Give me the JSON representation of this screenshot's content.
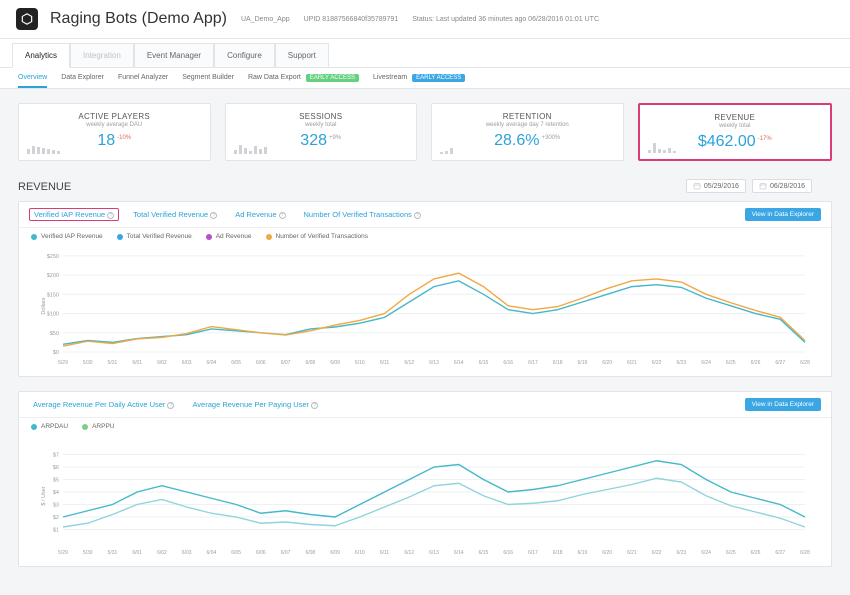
{
  "header": {
    "app_title": "Raging Bots (Demo App)",
    "project_label": "UA_Demo_App",
    "upid": "UPID 81887566840f35789791",
    "status": "Status: Last updated 36 minutes ago 06/28/2016 01:01 UTC"
  },
  "tabs": {
    "analytics": "Analytics",
    "integration": "Integration",
    "event_manager": "Event Manager",
    "configure": "Configure",
    "support": "Support"
  },
  "subtabs": {
    "overview": "Overview",
    "data_explorer": "Data Explorer",
    "funnel": "Funnel Analyzer",
    "segment": "Segment Builder",
    "raw": "Raw Data Export",
    "livestream": "Livestream",
    "badge_early": "EARLY ACCESS"
  },
  "cards": {
    "active_players": {
      "title": "ACTIVE PLAYERS",
      "sub": "weekly average DAU",
      "value": "18",
      "delta": "-10%"
    },
    "sessions": {
      "title": "SESSIONS",
      "sub": "weekly total",
      "value": "328",
      "delta": "+9%"
    },
    "retention": {
      "title": "RETENTION",
      "sub": "weekly average day 7 retention",
      "value": "28.6%",
      "delta": "+300%"
    },
    "revenue": {
      "title": "REVENUE",
      "sub": "weekly total",
      "value": "$462.00",
      "delta": "-17%"
    }
  },
  "section": {
    "revenue_title": "REVENUE"
  },
  "dates": {
    "from": "05/29/2016",
    "to": "06/28/2016"
  },
  "panel1": {
    "tabs": {
      "verified_iap": "Verified IAP Revenue",
      "total_verified": "Total Verified Revenue",
      "ad": "Ad Revenue",
      "num_tx": "Number Of Verified Transactions"
    },
    "view_btn": "View in Data Explorer",
    "legend": {
      "verified_iap": "Verified IAP Revenue",
      "total_verified": "Total Verified Revenue",
      "ad": "Ad Revenue",
      "num_tx": "Number of Verified Transactions"
    },
    "ylabel": "Dollars"
  },
  "panel2": {
    "tabs": {
      "arpdau": "Average Revenue Per Daily Active User",
      "arppu": "Average Revenue Per Paying User"
    },
    "view_btn": "View in Data Explorer",
    "legend": {
      "arpdau": "ARPDAU",
      "arppu": "ARPPU"
    },
    "ylabel": "$ / User"
  },
  "chart_data": [
    {
      "type": "line",
      "title": "Revenue",
      "xlabel": "",
      "ylabel": "Dollars",
      "ylim": [
        0,
        260
      ],
      "x": [
        "5/29",
        "5/30",
        "5/31",
        "6/01",
        "6/02",
        "6/03",
        "6/04",
        "6/05",
        "6/06",
        "6/07",
        "6/08",
        "6/09",
        "6/10",
        "6/11",
        "6/12",
        "6/13",
        "6/14",
        "6/15",
        "6/16",
        "6/17",
        "6/18",
        "6/19",
        "6/20",
        "6/21",
        "6/22",
        "6/23",
        "6/24",
        "6/25",
        "6/26",
        "6/27",
        "6/28"
      ],
      "series": [
        {
          "name": "Verified IAP Revenue",
          "color": "#45b8c9",
          "values": [
            20,
            30,
            25,
            35,
            40,
            45,
            60,
            55,
            50,
            45,
            60,
            65,
            75,
            90,
            130,
            170,
            185,
            150,
            110,
            100,
            110,
            130,
            150,
            170,
            175,
            168,
            140,
            120,
            100,
            85,
            25
          ]
        },
        {
          "name": "Number of Verified Transactions",
          "color": "#f0a844",
          "values": [
            15,
            28,
            22,
            34,
            38,
            48,
            66,
            58,
            50,
            44,
            55,
            70,
            82,
            100,
            150,
            190,
            205,
            170,
            120,
            110,
            118,
            140,
            165,
            185,
            190,
            182,
            150,
            128,
            108,
            90,
            30
          ]
        }
      ],
      "y_ticks": [
        0,
        50,
        100,
        150,
        200,
        250
      ]
    },
    {
      "type": "line",
      "title": "Average Revenue",
      "xlabel": "",
      "ylabel": "$ / User",
      "ylim": [
        0,
        8
      ],
      "x": [
        "5/29",
        "5/30",
        "5/31",
        "6/01",
        "6/02",
        "6/03",
        "6/04",
        "6/05",
        "6/06",
        "6/07",
        "6/08",
        "6/09",
        "6/10",
        "6/11",
        "6/12",
        "6/13",
        "6/14",
        "6/15",
        "6/16",
        "6/17",
        "6/18",
        "6/19",
        "6/20",
        "6/21",
        "6/22",
        "6/23",
        "6/24",
        "6/25",
        "6/26",
        "6/27",
        "6/28"
      ],
      "series": [
        {
          "name": "ARPDAU",
          "color": "#45b8c9",
          "values": [
            2,
            2.5,
            3,
            4,
            4.5,
            4,
            3.5,
            3,
            2.3,
            2.5,
            2.2,
            2,
            3,
            4,
            5,
            6,
            6.2,
            5,
            4,
            4.2,
            4.5,
            5,
            5.5,
            6,
            6.5,
            6.2,
            5,
            4,
            3.5,
            3,
            2
          ]
        },
        {
          "name": "ARPPU",
          "color": "#8fd4dd",
          "values": [
            1.2,
            1.5,
            2.2,
            3,
            3.4,
            2.8,
            2.3,
            2,
            1.5,
            1.6,
            1.4,
            1.3,
            2,
            2.8,
            3.6,
            4.5,
            4.7,
            3.7,
            3,
            3.1,
            3.3,
            3.8,
            4.2,
            4.6,
            5.1,
            4.8,
            3.7,
            2.9,
            2.4,
            1.9,
            1.2
          ]
        }
      ],
      "y_ticks": [
        1,
        2,
        3,
        4,
        5,
        6,
        7
      ]
    }
  ]
}
